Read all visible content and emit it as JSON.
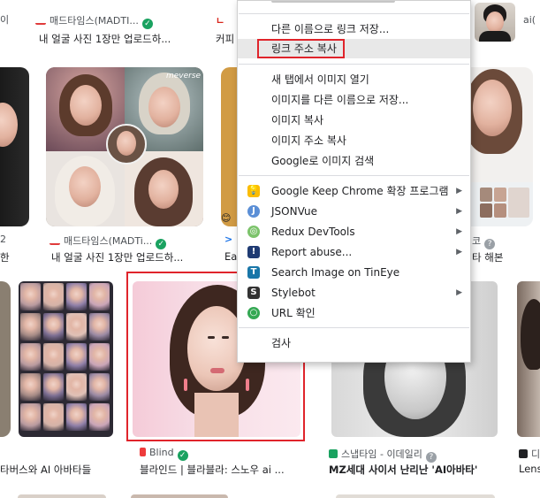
{
  "results": {
    "top_row": [
      {
        "source": "매드타임스(MADTI...",
        "title": "내 얼굴 사진 1장만 업로드하..."
      },
      {
        "source": "ㄴ",
        "title": "커피"
      },
      {
        "source": "ai(",
        "title": ""
      }
    ],
    "left_cut": {
      "title": "이",
      "title2": "한"
    },
    "middle_row": [
      {
        "source": "매드타임스(MADTi...",
        "title": "내 얼굴 사진 1장만 업로드하...",
        "watermark": "meverse"
      },
      {
        "source": "",
        "title": "Ea"
      },
      {
        "source": "코",
        "title": "타 해본"
      }
    ],
    "bottom_row": [
      {
        "source": "",
        "title": "타버스와 AI 아바타들"
      },
      {
        "source": "Blind",
        "title": "블라인드 | 블라블라: 스노우 ai ..."
      },
      {
        "source": "스냅타임 - 이데일리",
        "title": "MZ세대 사이서 난리난 'AI아바타'"
      },
      {
        "source": "디",
        "title": "Lens"
      }
    ]
  },
  "context_menu": {
    "items": [
      {
        "label": "다른 이름으로 링크 저장...",
        "has_icon": false,
        "submenu": false
      },
      {
        "label": "링크 주소 복사",
        "has_icon": false,
        "submenu": false,
        "highlighted": true
      },
      {
        "label": "새 탭에서 이미지 열기",
        "has_icon": false,
        "submenu": false
      },
      {
        "label": "이미지를 다른 이름으로 저장...",
        "has_icon": false,
        "submenu": false
      },
      {
        "label": "이미지 복사",
        "has_icon": false,
        "submenu": false
      },
      {
        "label": "이미지 주소 복사",
        "has_icon": false,
        "submenu": false
      },
      {
        "label": "Google로 이미지 검색",
        "has_icon": false,
        "submenu": false
      },
      {
        "label": "Google Keep Chrome 확장 프로그램",
        "icon": "google-keep-icon",
        "icon_color": "#fbbc04",
        "submenu": true
      },
      {
        "label": "JSONVue",
        "icon": "jsonvue-icon",
        "icon_color": "#5b8fd6",
        "submenu": true
      },
      {
        "label": "Redux DevTools",
        "icon": "redux-devtools-icon",
        "icon_color": "#7cc36b",
        "submenu": true
      },
      {
        "label": "Report abuse...",
        "icon": "report-abuse-icon",
        "icon_color": "#1f3b73",
        "submenu": true
      },
      {
        "label": "Search Image on TinEye",
        "icon": "tineye-icon",
        "icon_color": "#1976a8",
        "submenu": false
      },
      {
        "label": "Stylebot",
        "icon": "stylebot-icon",
        "icon_color": "#333333",
        "submenu": true
      },
      {
        "label": "URL 확인",
        "icon": "url-check-icon",
        "icon_color": "#34a853",
        "submenu": false
      },
      {
        "label": "검사",
        "has_icon": false,
        "submenu": false
      }
    ],
    "highlight_color": "#e8e8e8",
    "annotation_color": "#e0242b"
  }
}
